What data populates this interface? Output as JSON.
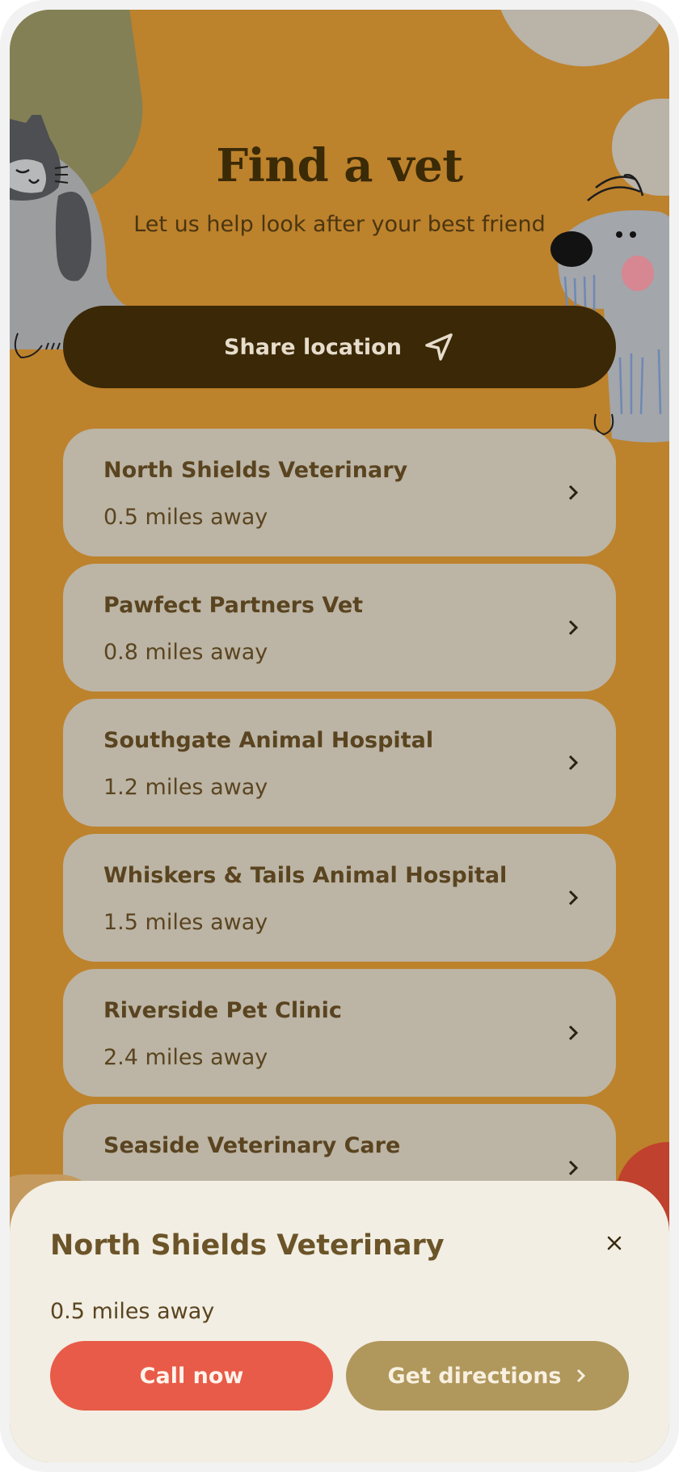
{
  "header": {
    "title": "Find a vet",
    "subtitle": "Let us help look after your best friend"
  },
  "share_button": {
    "label": "Share location",
    "icon": "navigation-arrow-icon"
  },
  "vets": [
    {
      "name": "North Shields Veterinary",
      "distance": "0.5 miles away"
    },
    {
      "name": "Pawfect Partners Vet",
      "distance": "0.8 miles away"
    },
    {
      "name": "Southgate Animal Hospital",
      "distance": "1.2 miles away"
    },
    {
      "name": "Whiskers & Tails Animal Hospital",
      "distance": "1.5 miles away"
    },
    {
      "name": "Riverside Pet Clinic",
      "distance": "2.4 miles away"
    },
    {
      "name": "Seaside Veterinary Care",
      "distance": ""
    }
  ],
  "sheet": {
    "title": "North Shields Veterinary",
    "distance": "0.5 miles away",
    "close_icon": "close-icon",
    "call_label": "Call now",
    "directions_label": "Get directions"
  },
  "colors": {
    "background": "#bd822c",
    "share_button": "#3a2806",
    "card": "#bcb5a5",
    "sheet": "#f2eee3",
    "call_button": "#e85b48",
    "directions_button": "#b0975c"
  }
}
